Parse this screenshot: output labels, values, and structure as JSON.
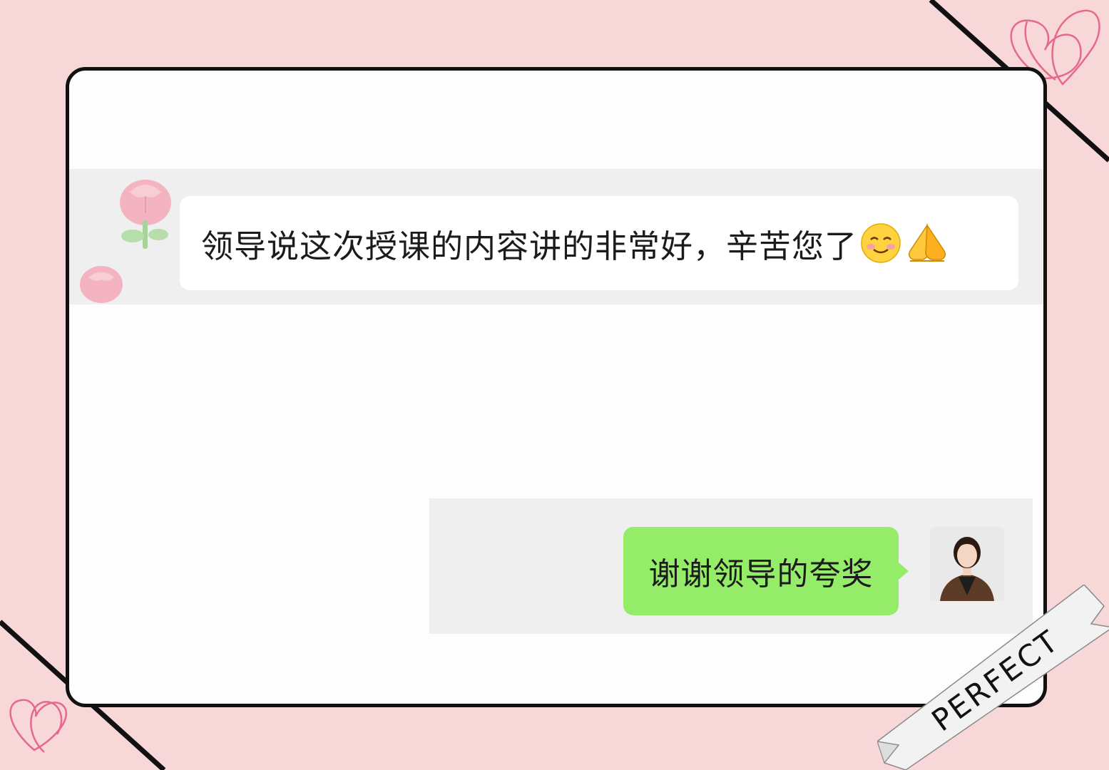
{
  "colors": {
    "background": "#f8d7d9",
    "frame_border": "#111111",
    "chat_background": "#fdfdfd",
    "incoming_bubble": "#ffffff",
    "outgoing_bubble": "#95ec69"
  },
  "chat": {
    "incoming": {
      "text": "领导说这次授课的内容讲的非常好，辛苦您了",
      "emojis": [
        "smiling-face-icon",
        "folded-hands-icon"
      ],
      "avatar": "tulip-avatar-icon"
    },
    "outgoing": {
      "text": "谢谢领导的夸奖",
      "avatar": "user-photo-avatar"
    }
  },
  "decoration": {
    "ribbon_text": "PERFECT"
  }
}
